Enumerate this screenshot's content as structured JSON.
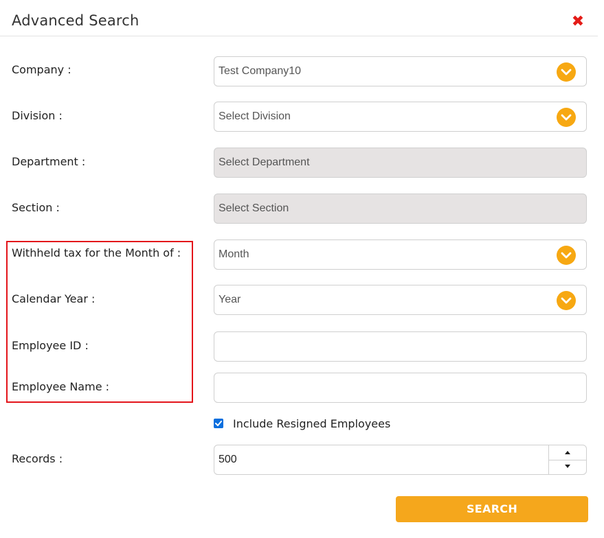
{
  "dialog": {
    "title": "Advanced Search",
    "close_icon": "close-icon"
  },
  "colors": {
    "accent": "#f7a812",
    "close": "#e41b17",
    "highlight_border": "#e3141a",
    "checkbox": "#0b6fde",
    "disabled_bg": "#e6e3e3"
  },
  "fields": {
    "company": {
      "label": "Company :",
      "value": "Test Company10"
    },
    "division": {
      "label": "Division :",
      "value": "Select Division"
    },
    "department": {
      "label": "Department :",
      "value": "Select Department"
    },
    "section": {
      "label": "Section :",
      "value": "Select Section"
    },
    "month": {
      "label": "Withheld tax for the Month of :",
      "value": "Month"
    },
    "year": {
      "label": "Calendar Year :",
      "value": "Year"
    },
    "employee_id": {
      "label": "Employee ID :",
      "value": ""
    },
    "employee_name": {
      "label": "Employee Name :",
      "value": ""
    },
    "records": {
      "label": "Records :",
      "value": "500"
    }
  },
  "include_resigned": {
    "label": "Include Resigned Employees",
    "checked": true
  },
  "search_button": {
    "label": "SEARCH"
  }
}
